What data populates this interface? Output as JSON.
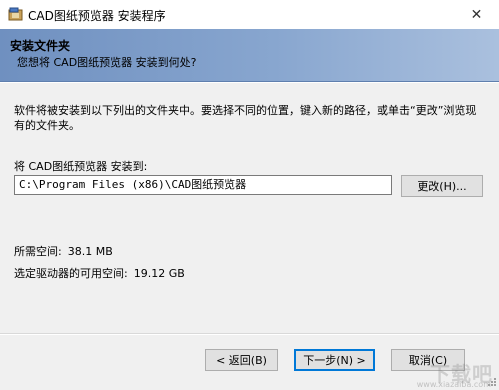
{
  "window": {
    "title": "CAD图纸预览器 安装程序",
    "icon": "installer-app-icon",
    "close_glyph": "✕"
  },
  "header": {
    "title": "安装文件夹",
    "subtitle": "您想将 CAD图纸预览器 安装到何处?"
  },
  "body": {
    "description": "软件将被安装到以下列出的文件夹中。要选择不同的位置，键入新的路径，或单击“更改”浏览现有的文件夹。",
    "install_to_label": "将 CAD图纸预览器 安装到:",
    "install_path": "C:\\Program Files (x86)\\CAD图纸预览器",
    "browse_button": "更改(H)...",
    "required_space_label": "所需空间:",
    "required_space_value": "38.1 MB",
    "available_space_label": "选定驱动器的可用空间:",
    "available_space_value": "19.12 GB"
  },
  "footer": {
    "back_button": "< 返回(B)",
    "next_button": "下一步(N) >",
    "cancel_button": "取消(C)"
  },
  "watermark": {
    "text": "下载吧",
    "url": "www.xiazaiba.com"
  },
  "colors": {
    "header_gradient_start": "#6f90c0",
    "header_gradient_end": "#aac0de",
    "dialog_bg": "#f0f0f0",
    "default_button_border": "#0078d7"
  }
}
